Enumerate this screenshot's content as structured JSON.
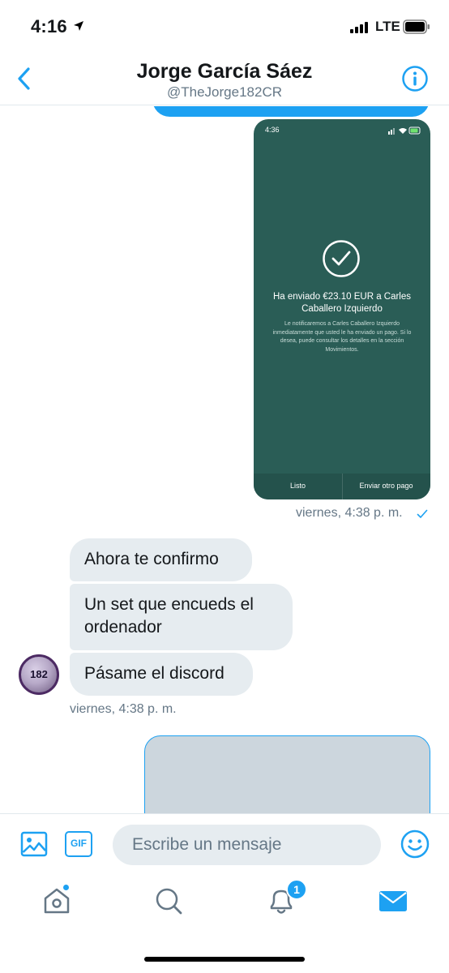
{
  "status_bar": {
    "time": "4:16",
    "network": "LTE"
  },
  "header": {
    "title": "Jorge García Sáez",
    "handle": "@TheJorge182CR",
    "back_icon": "chevron-left-icon",
    "info_icon": "info-icon"
  },
  "conversation": {
    "sent_image": {
      "status_time": "4:36",
      "title": "Ha enviado €23.10 EUR a Carles Caballero Izquierdo",
      "body": "Le notificaremos a Carles Caballero Izquierdo inmediatamente que usted le ha enviado un pago. Si lo desea, puede consultar los detalles en la sección Movimientos.",
      "button_left": "Listo",
      "button_right": "Enviar otro pago"
    },
    "sent_timestamp": "viernes, 4:38 p. m.",
    "received_messages": [
      "Ahora te confirmo",
      "Un set que encueds el ordenador",
      "Pásame el discord"
    ],
    "avatar_text": "182",
    "received_timestamp": "viernes, 4:38 p. m."
  },
  "composer": {
    "placeholder": "Escribe un mensaje",
    "gif_label": "GIF"
  },
  "tabbar": {
    "notification_count": "1"
  },
  "colors": {
    "accent": "#1da1f2",
    "bubble_incoming": "#e6ecf0",
    "screenshot_bg": "#2a5d56",
    "muted_text": "#657786"
  }
}
